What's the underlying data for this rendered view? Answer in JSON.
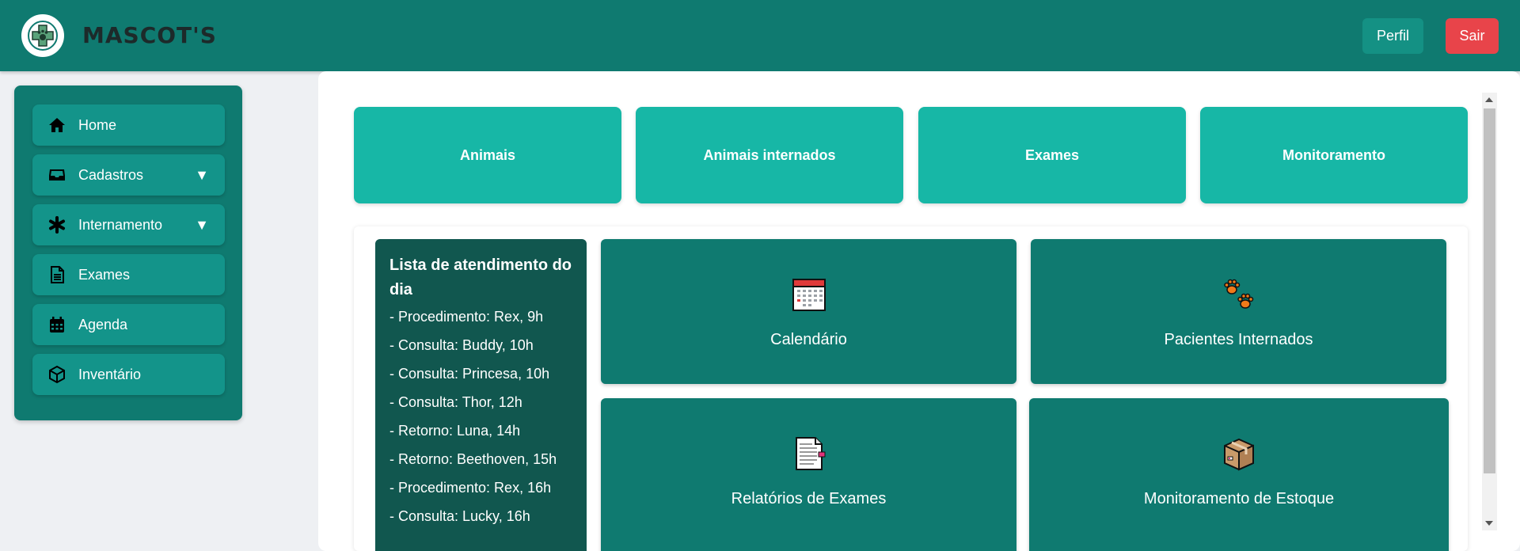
{
  "header": {
    "brand": "MASCOT'S",
    "logo_icon": "paw-cross-logo",
    "perfil_label": "Perfil",
    "sair_label": "Sair",
    "bg_color": "#0f7a70",
    "sair_color": "#e8444a"
  },
  "sidebar": {
    "items": [
      {
        "label": "Home",
        "icon": "home-icon"
      },
      {
        "label": "Cadastros",
        "icon": "inbox-icon",
        "caret": "▼"
      },
      {
        "label": "Internamento",
        "icon": "asterisk-icon",
        "caret": "▼"
      },
      {
        "label": "Exames",
        "icon": "document-icon"
      },
      {
        "label": "Agenda",
        "icon": "calendar-icon"
      },
      {
        "label": "Inventário",
        "icon": "box-icon"
      }
    ]
  },
  "quick_cards": [
    {
      "label": "Animais"
    },
    {
      "label": "Animais internados"
    },
    {
      "label": "Exames"
    },
    {
      "label": "Monitoramento"
    }
  ],
  "daily_list": {
    "title": "Lista de atendimento do dia",
    "items": [
      "- Procedimento: Rex, 9h",
      "- Consulta: Buddy, 10h",
      "- Consulta: Princesa, 10h",
      "- Consulta: Thor, 12h",
      "- Retorno: Luna, 14h",
      "- Retorno: Beethoven, 15h",
      "- Procedimento: Rex, 16h",
      "- Consulta: Lucky, 16h"
    ]
  },
  "tiles": [
    {
      "label": "Calendário",
      "icon": "calendar-emoji-icon"
    },
    {
      "label": "Pacientes Internados",
      "icon": "paw-prints-icon"
    },
    {
      "label": "Relatórios de Exames",
      "icon": "page-report-icon"
    },
    {
      "label": "Monitoramento de Estoque",
      "icon": "package-icon"
    }
  ],
  "colors": {
    "accent": "#17b7a6",
    "tile": "#0f7a70",
    "list_panel": "#11574f"
  }
}
